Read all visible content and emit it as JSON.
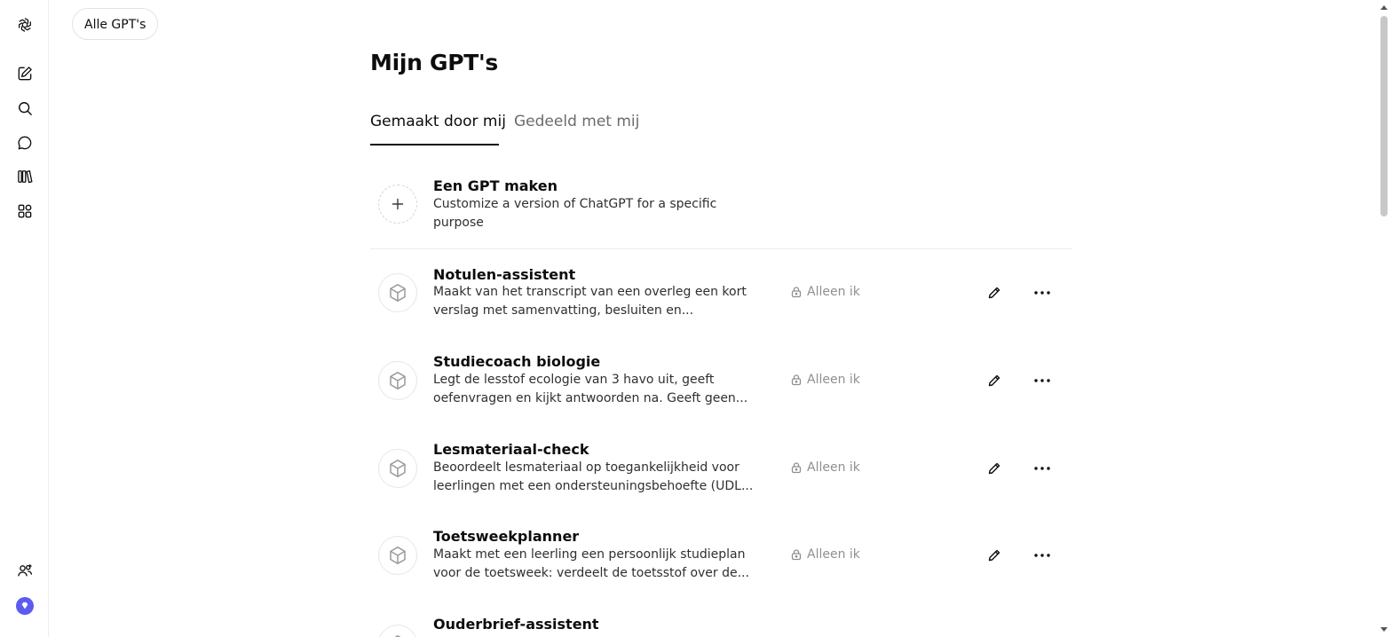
{
  "nav": {
    "all_gpts": "Alle GPT's"
  },
  "page": {
    "title": "Mijn GPT's",
    "tabs": [
      {
        "label": "Gemaakt door mij",
        "active": true
      },
      {
        "label": "Gedeeld met mij",
        "active": false
      }
    ]
  },
  "create": {
    "title": "Een GPT maken",
    "desc_line1": "Customize a version of ChatGPT for a specific",
    "desc_line2": "purpose"
  },
  "gpts": [
    {
      "name": "Notulen-assistent",
      "line1": "Maakt van het transcript van een overleg een kort",
      "line2": "verslag met samenvatting, besluiten en...",
      "visibility": "Alleen ik"
    },
    {
      "name": "Studiecoach biologie",
      "line1": "Legt de lesstof ecologie van 3 havo uit, geeft",
      "line2": "oefenvragen en kijkt antwoorden na. Geeft geen...",
      "visibility": "Alleen ik"
    },
    {
      "name": "Lesmateriaal-check",
      "line1": "Beoordeelt lesmateriaal op toegankelijkheid voor",
      "line2": "leerlingen met een ondersteuningsbehoefte (UDL...",
      "visibility": "Alleen ik"
    },
    {
      "name": "Toetsweekplanner",
      "line1": "Maakt met een leerling een persoonlijk studieplan",
      "line2": "voor de toetsweek: verdeelt de toetsstof over de...",
      "visibility": "Alleen ik"
    },
    {
      "name": "Ouderbrief-assistent",
      "line1": "",
      "line2": "",
      "visibility": ""
    }
  ],
  "icons": {
    "logo": "openai-logo-icon",
    "new_chat": "edit-icon",
    "search": "search-icon",
    "chats": "chat-bubble-icon",
    "library": "library-icon",
    "gpts": "apps-icon",
    "people": "people-icon",
    "upgrade": "diamond-icon"
  },
  "colors": {
    "upgrade_badge": "#5b5bf0",
    "muted_text": "#8f8f8f"
  }
}
